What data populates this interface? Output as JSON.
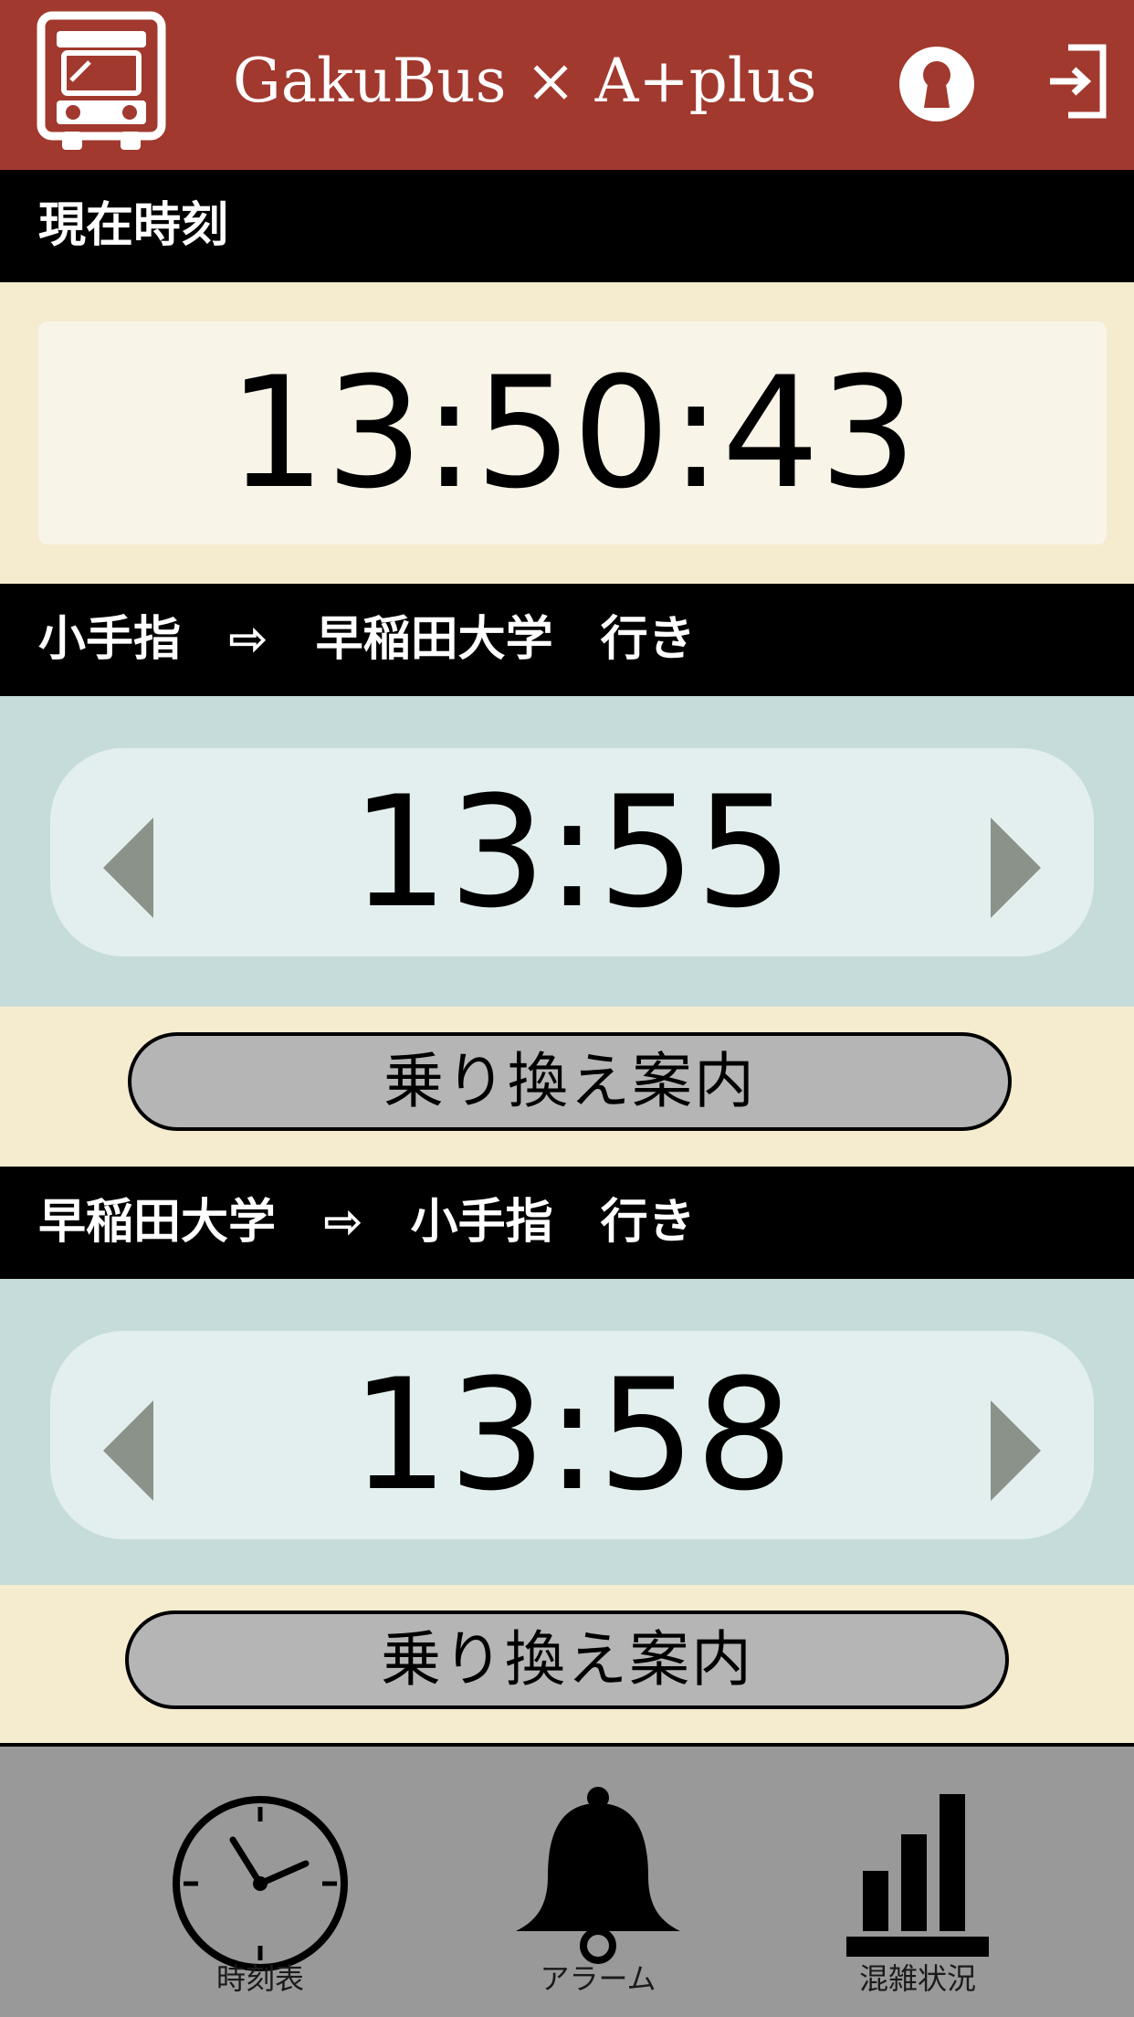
{
  "header": {
    "title": "GakuBus × A+plus",
    "logo_icon": "bus-icon",
    "user_icon": "user-keyhole-icon",
    "logout_icon": "logout-icon",
    "brand_color": "#a1392e"
  },
  "current_time": {
    "label": "現在時刻",
    "value": "13:50:43"
  },
  "routes": [
    {
      "title": "小手指　⇨　早稲田大学　行き",
      "departure": "13:55",
      "transfer_label": "乗り換え案内"
    },
    {
      "title": "早稲田大学　⇨　小手指　行き",
      "departure": "13:58",
      "transfer_label": "乗り換え案内"
    }
  ],
  "nav": {
    "items": [
      {
        "label": "時刻表",
        "icon": "clock-icon"
      },
      {
        "label": "アラーム",
        "icon": "bell-icon"
      },
      {
        "label": "混雑状況",
        "icon": "bar-chart-icon"
      }
    ]
  },
  "colors": {
    "cream": "#f5ecd0",
    "teal": "#c5dcda",
    "nav_bg": "#999999"
  }
}
